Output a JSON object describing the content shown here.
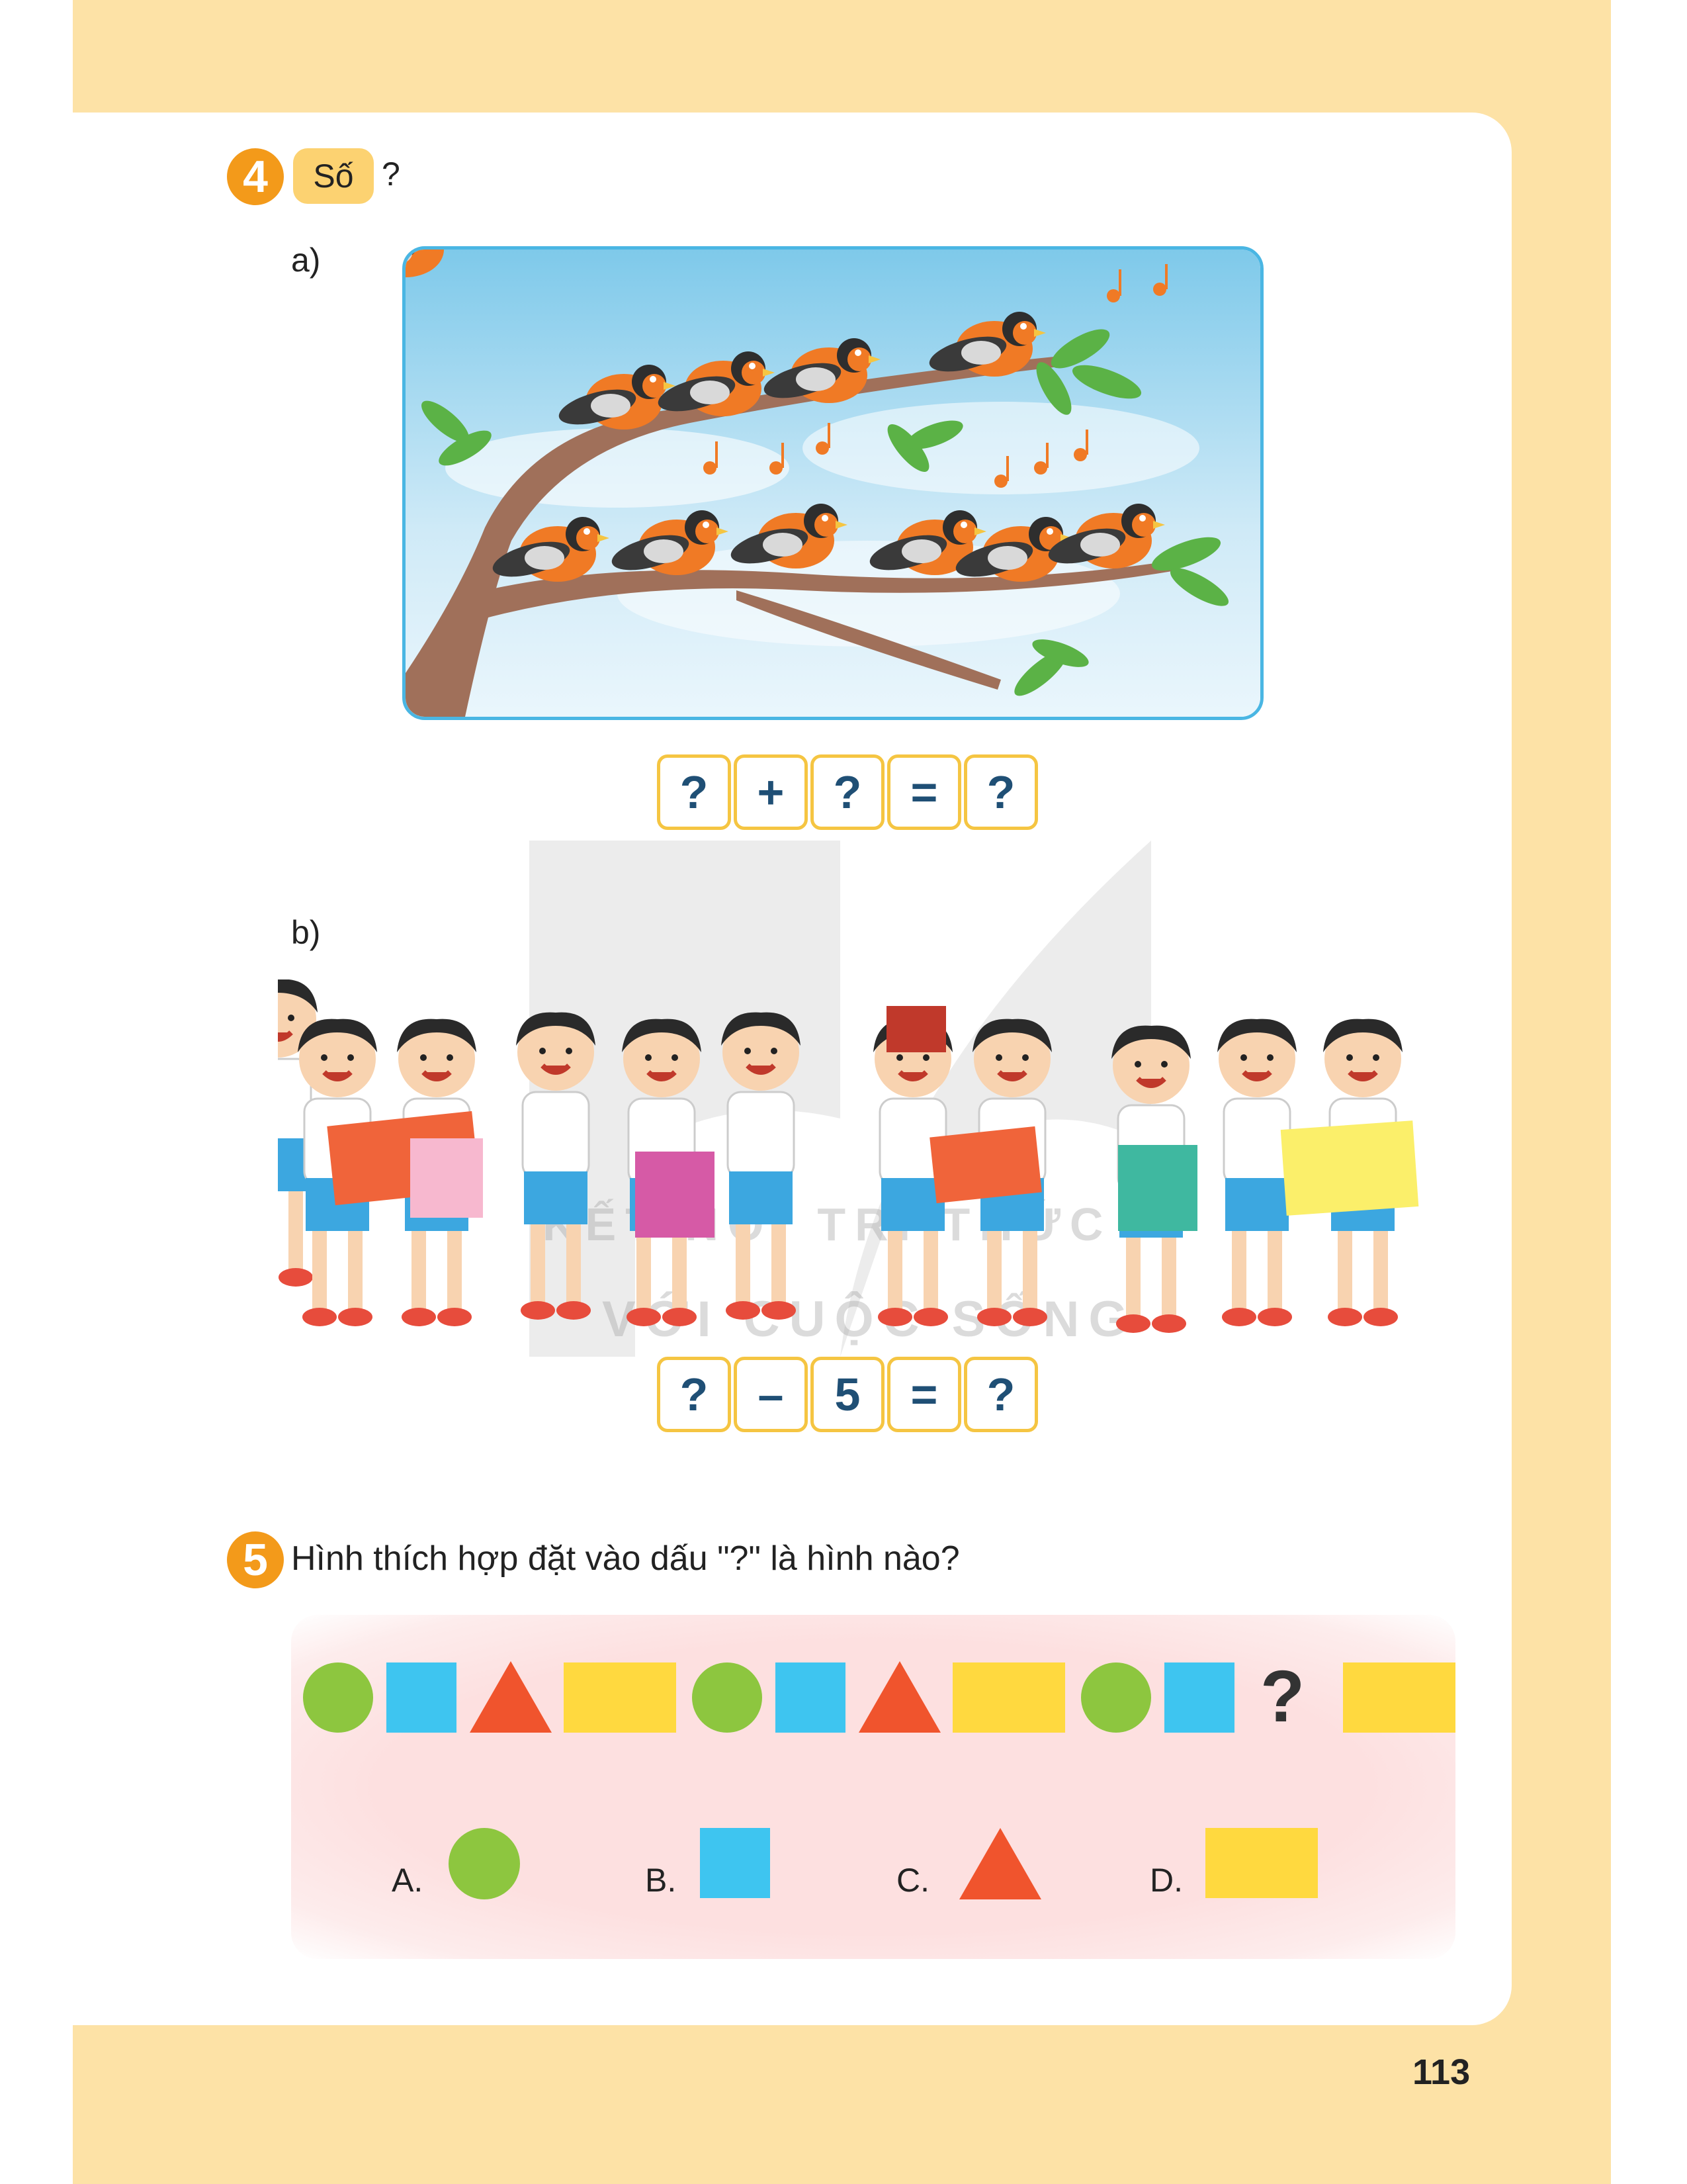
{
  "page": {
    "number": "113"
  },
  "exercise4": {
    "number": "4",
    "tag": "Số",
    "question_mark": "?",
    "part_a": {
      "label": "a)",
      "equation": [
        "?",
        "+",
        "?",
        "=",
        "?"
      ]
    },
    "part_b": {
      "label": "b)",
      "equation": [
        "?",
        "–",
        "5",
        "=",
        "?"
      ]
    }
  },
  "exercise5": {
    "number": "5",
    "question": "Hình thích hợp đặt vào dấu \"?\" là hình nào?",
    "sequence": [
      "circle",
      "square",
      "triangle",
      "rectangle",
      "circle",
      "square",
      "triangle",
      "rectangle",
      "circle",
      "square",
      "?",
      "rectangle"
    ],
    "missing_mark": "?",
    "options": [
      {
        "letter": "A.",
        "shape": "circle"
      },
      {
        "letter": "B.",
        "shape": "square"
      },
      {
        "letter": "C.",
        "shape": "triangle"
      },
      {
        "letter": "D.",
        "shape": "rectangle"
      }
    ]
  },
  "colors": {
    "frame": "#fde2a6",
    "badge": "#f39a1a",
    "circle": "#8dc63f",
    "square": "#3ec5f0",
    "triangle": "#f0542d",
    "rectangle": "#ffd93f",
    "equation_border": "#f5c542",
    "equation_text": "#1f4f75"
  },
  "watermark": {
    "line1": "KẾT NỐI TRI THỨC",
    "line2": "VỚI CUỘC SỐNG"
  }
}
